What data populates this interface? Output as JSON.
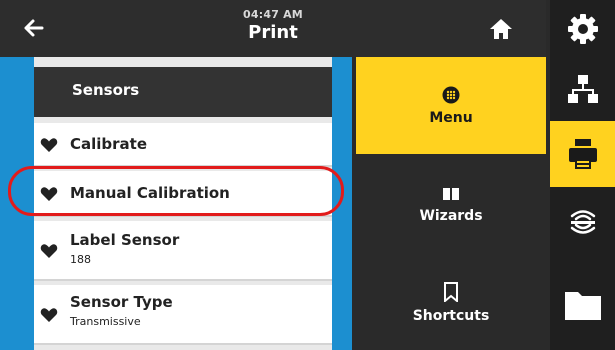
{
  "header": {
    "time": "04:47 AM",
    "title": "Print"
  },
  "list": {
    "section_title": "Sensors",
    "items": [
      {
        "label": "Calibrate",
        "sub": ""
      },
      {
        "label": "Manual Calibration",
        "sub": ""
      },
      {
        "label": "Label Sensor",
        "sub": "188"
      },
      {
        "label": "Sensor Type",
        "sub": "Transmissive"
      }
    ]
  },
  "nav": {
    "menu": "Menu",
    "wizards": "Wizards",
    "shortcuts": "Shortcuts"
  },
  "icons": {
    "back": "arrow-left-icon",
    "home": "home-icon",
    "menu": "grid-dots-icon",
    "wizards": "book-icon",
    "shortcuts": "bookmark-icon",
    "rail": [
      "gear-icon",
      "network-icon",
      "printer-icon",
      "wireless-icon",
      "folder-icon"
    ],
    "item": "heart-icon"
  },
  "colors": {
    "accent_yellow": "#ffd21f",
    "panel_blue": "#1c8fd0",
    "highlight_red": "#e21b1b"
  }
}
